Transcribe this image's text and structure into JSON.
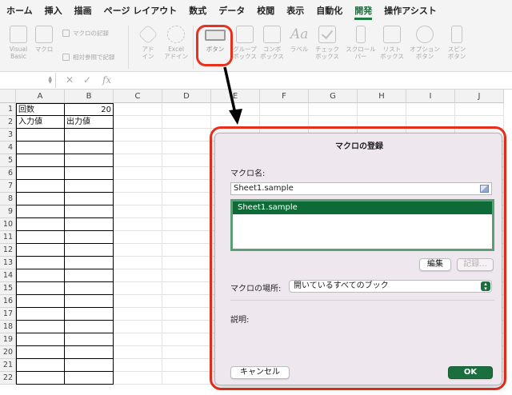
{
  "ribbon_tabs": [
    "ホーム",
    "挿入",
    "描画",
    "ページ レイアウト",
    "数式",
    "データ",
    "校閲",
    "表示",
    "自動化",
    "開発",
    "操作アシスト"
  ],
  "active_tab": "開発",
  "ribbon": {
    "visual_basic": [
      "Visual",
      "Basic"
    ],
    "macro": "マクロ",
    "record_macro": "マクロの記録",
    "relative_ref": "相対参照で記録",
    "addins": [
      "アド",
      "イン"
    ],
    "excel_addins": [
      "Excel",
      "アドイン"
    ],
    "button": "ボタン",
    "group_box": [
      "グループ",
      "ボックス"
    ],
    "combo_box": [
      "コンボ",
      "ボックス"
    ],
    "label": "ラベル",
    "check_box": [
      "チェック",
      "ボックス"
    ],
    "scroll_bar": [
      "スクロール",
      "バー"
    ],
    "list_box": [
      "リスト",
      "ボックス"
    ],
    "option_button": [
      "オプション",
      "ボタン"
    ],
    "spin_button": [
      "スピン",
      "ボタン"
    ]
  },
  "formula_bar": {
    "fx": "fx",
    "cancel": "✕",
    "enter": "✓"
  },
  "sheet": {
    "columns": [
      "A",
      "B",
      "C",
      "D",
      "E",
      "F",
      "G",
      "H",
      "I",
      "J"
    ],
    "rows": [
      "1",
      "2",
      "3",
      "4",
      "5",
      "6",
      "7",
      "8",
      "9",
      "10",
      "11",
      "12",
      "13",
      "14",
      "15",
      "16",
      "17",
      "18",
      "19",
      "20",
      "21",
      "22"
    ],
    "a1": "回数",
    "b1": "20",
    "a2": "入力値",
    "b2": "出力値"
  },
  "dialog": {
    "title": "マクロの登録",
    "macro_name_label": "マクロ名:",
    "macro_name_value": "Sheet1.sample",
    "list_items": [
      "Sheet1.sample"
    ],
    "edit_button": "編集",
    "record_button": "記録...",
    "location_label": "マクロの場所:",
    "location_value": "開いているすべてのブック",
    "description_label": "説明:",
    "cancel_button": "キャンセル",
    "ok_button": "OK"
  },
  "colors": {
    "highlight": "#e8301e",
    "accent": "#1b6e3d",
    "dialog_bg": "#efe7ee"
  }
}
